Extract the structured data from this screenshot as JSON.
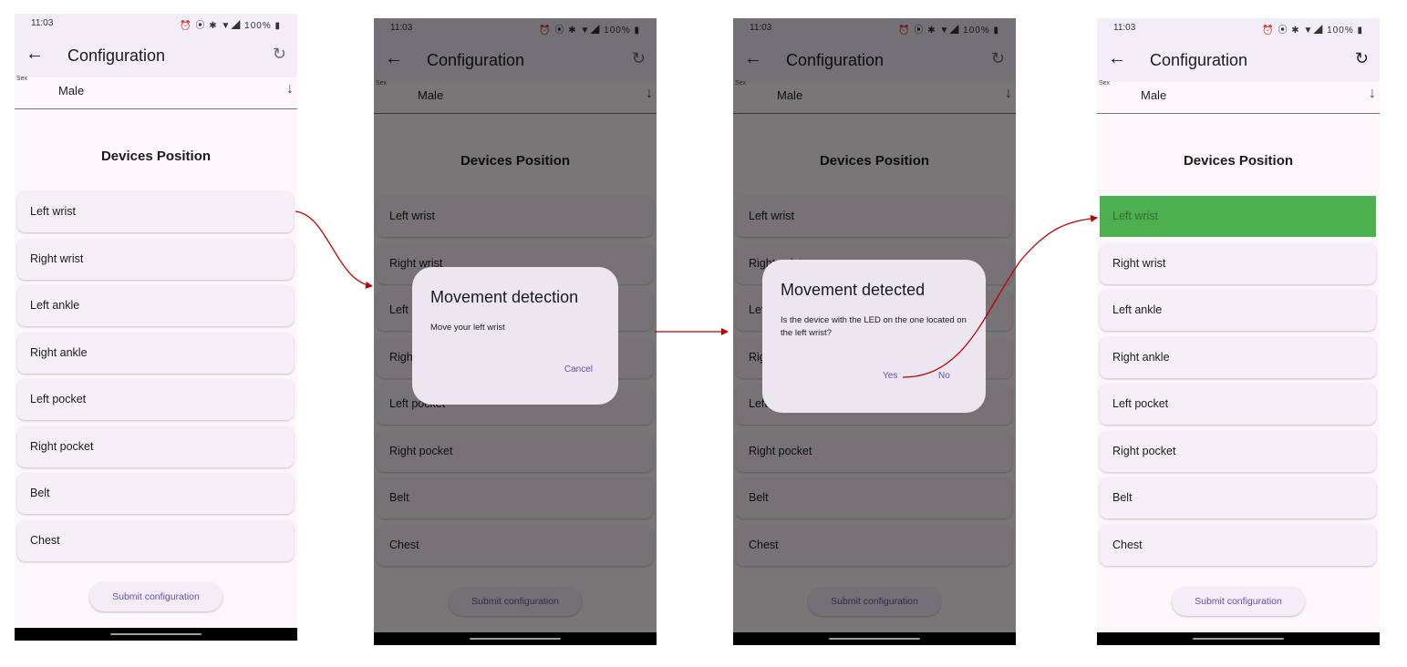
{
  "status": {
    "time": "11:03",
    "icons": "⏰ ⦿ ✱ ▼◢ 100% ▮"
  },
  "appbar": {
    "back_icon": "←",
    "title": "Configuration",
    "refresh_icon": "↻"
  },
  "sex_field": {
    "label": "Sex",
    "value": "Male",
    "arrow_icon": "↓"
  },
  "section_title": "Devices Position",
  "positions": [
    "Left wrist",
    "Right wrist",
    "Left ankle",
    "Right ankle",
    "Left pocket",
    "Right pocket",
    "Belt",
    "Chest"
  ],
  "submit_label": "Submit configuration",
  "dialog_detection": {
    "title": "Movement detection",
    "body": "Move your left wrist",
    "cancel": "Cancel"
  },
  "dialog_detected": {
    "title": "Movement detected",
    "body": "Is the device with the LED on the one located on the left wrist?",
    "yes": "Yes",
    "no": "No"
  },
  "colors": {
    "arrow": "#c00000",
    "selected": "#4caf50",
    "accent": "#6750a4"
  }
}
